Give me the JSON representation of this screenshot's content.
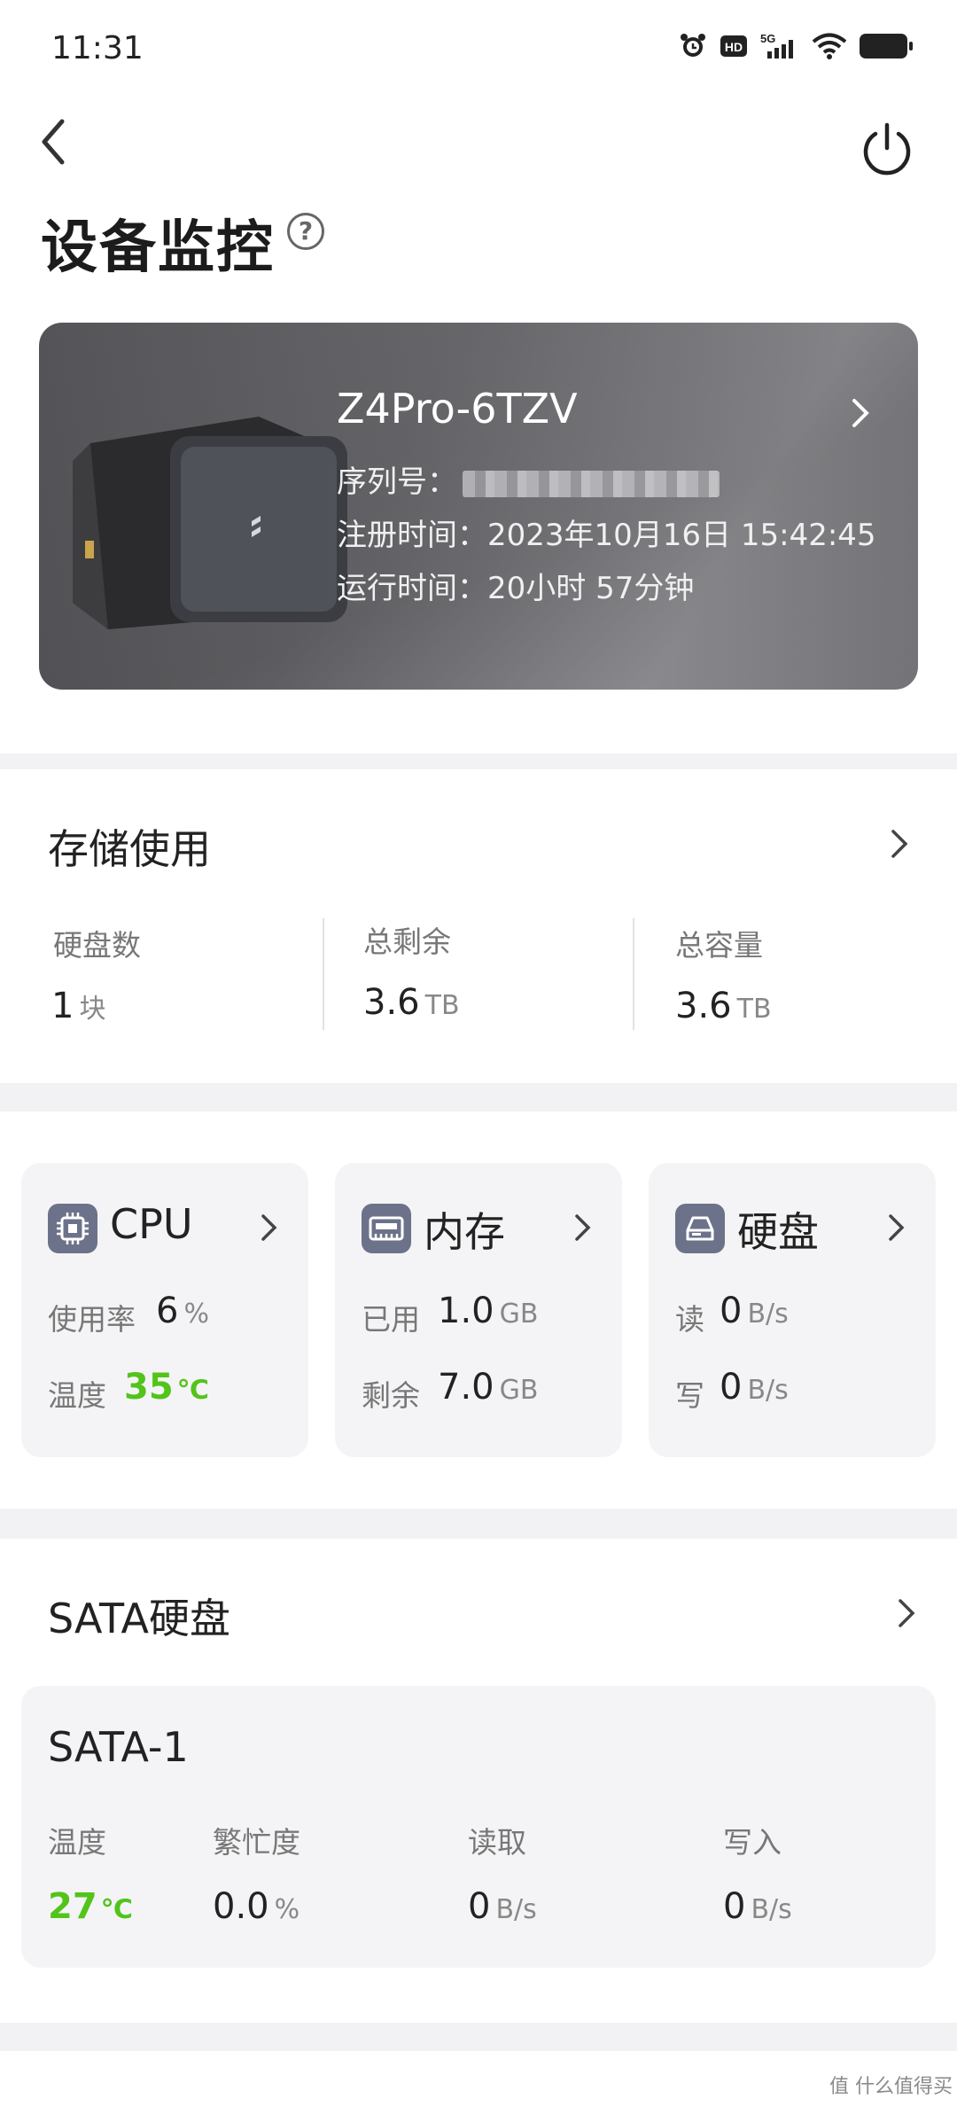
{
  "status_bar": {
    "time": "11:31",
    "icons": [
      "alarm-icon",
      "hd-icon",
      "5g-signal-icon",
      "wifi-icon",
      "battery-icon"
    ],
    "network_label": "5G",
    "hd_label": "HD"
  },
  "header": {
    "title": "设备监控",
    "help_symbol": "?",
    "back_icon": "chevron-left-icon",
    "power_icon": "power-icon"
  },
  "device": {
    "name": "Z4Pro-6TZV",
    "serial_label": "序列号：",
    "register_label": "注册时间：",
    "register_time": "2023年10月16日 15:42:45",
    "uptime_label": "运行时间：",
    "uptime": "20小时 57分钟"
  },
  "storage": {
    "title": "存储使用",
    "items": [
      {
        "label": "硬盘数",
        "value": "1",
        "unit": "块"
      },
      {
        "label": "总剩余",
        "value": "3.6",
        "unit": "TB"
      },
      {
        "label": "总容量",
        "value": "3.6",
        "unit": "TB"
      }
    ]
  },
  "cards": {
    "cpu": {
      "title": "CPU",
      "usage_label": "使用率",
      "usage_value": "6",
      "usage_unit": "%",
      "temp_label": "温度",
      "temp_value": "35",
      "temp_unit": "℃"
    },
    "memory": {
      "title": "内存",
      "used_label": "已用",
      "used_value": "1.0",
      "used_unit": "GB",
      "free_label": "剩余",
      "free_value": "7.0",
      "free_unit": "GB"
    },
    "disk": {
      "title": "硬盘",
      "read_label": "读",
      "read_value": "0",
      "read_unit": "B/s",
      "write_label": "写",
      "write_value": "0",
      "write_unit": "B/s"
    }
  },
  "sata": {
    "title": "SATA硬盘",
    "disk": {
      "name": "SATA-1",
      "temp_label": "温度",
      "temp_value": "27",
      "temp_unit": "℃",
      "busy_label": "繁忙度",
      "busy_value": "0.0",
      "busy_unit": "%",
      "read_label": "读取",
      "read_value": "0",
      "read_unit": "B/s",
      "write_label": "写入",
      "write_value": "0",
      "write_unit": "B/s"
    }
  },
  "watermark": "值 什么值得买",
  "colors": {
    "accent_green": "#52c41a",
    "icon_bg": "#6c7289",
    "card_bg": "#f4f4f6"
  }
}
